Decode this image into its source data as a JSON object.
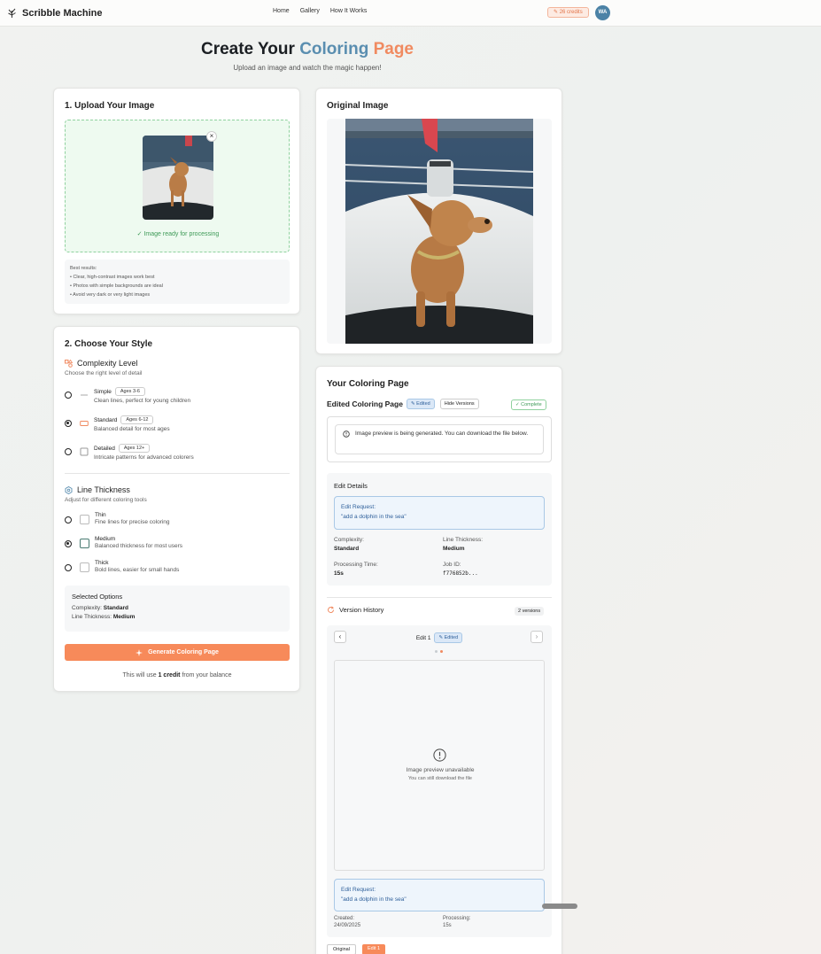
{
  "header": {
    "app_name": "Scribble Machine",
    "nav": [
      "Home",
      "Gallery",
      "How It Works"
    ],
    "credits": "✎ 26 credits",
    "avatar_initials": "WA"
  },
  "hero": {
    "title_part1": "Create Your ",
    "title_part2": "Coloring",
    "title_part3": " Page",
    "subtitle": "Upload an image and watch the magic happen!"
  },
  "upload": {
    "title": "1. Upload Your Image",
    "close": "×",
    "status": "✓ Image ready for processing",
    "tips_heading": "Best results:",
    "tips": [
      "• Clear, high-contrast images work best",
      "• Photos with simple backgrounds are ideal",
      "• Avoid very dark or very light images"
    ]
  },
  "style": {
    "title": "2. Choose Your Style",
    "complexity": {
      "heading": "Complexity Level",
      "sub": "Choose the right level of detail",
      "options": [
        {
          "label": "Simple",
          "age": "Ages 3-6",
          "desc": "Clean lines, perfect for young children",
          "selected": false
        },
        {
          "label": "Standard",
          "age": "Ages 6-12",
          "desc": "Balanced detail for most ages",
          "selected": true
        },
        {
          "label": "Detailed",
          "age": "Ages 12+",
          "desc": "Intricate patterns for advanced colorers",
          "selected": false
        }
      ]
    },
    "thickness": {
      "heading": "Line Thickness",
      "sub": "Adjust for different coloring tools",
      "options": [
        {
          "label": "Thin",
          "desc": "Fine lines for precise coloring",
          "selected": false
        },
        {
          "label": "Medium",
          "desc": "Balanced thickness for most users",
          "selected": true
        },
        {
          "label": "Thick",
          "desc": "Bold lines, easier for small hands",
          "selected": false
        }
      ]
    },
    "selected": {
      "heading": "Selected Options",
      "complexity_label": "Complexity:",
      "complexity_value": "Standard",
      "thickness_label": "Line Thickness:",
      "thickness_value": "Medium"
    },
    "generate_button": "Generate Coloring Page",
    "credit_note_pre": "This will use ",
    "credit_note_bold": "1 credit",
    "credit_note_post": " from your balance"
  },
  "original": {
    "title": "Original Image"
  },
  "result": {
    "title": "Your Coloring Page",
    "subtitle": "Edited Coloring Page",
    "edited_badge": "✎ Edited",
    "hide_versions": "Hide Versions",
    "complete_badge": "✓ Complete",
    "notice": "Image preview is being generated. You can download the file below.",
    "edit_details": {
      "heading": "Edit Details",
      "request_label": "Edit Request:",
      "request_text": "\"add a dolphin in the sea\"",
      "complexity_label": "Complexity:",
      "complexity_value": "Standard",
      "thickness_label": "Line Thickness:",
      "thickness_value": "Medium",
      "time_label": "Processing Time:",
      "time_value": "15s",
      "job_label": "Job ID:",
      "job_value": "f776852b..."
    },
    "history": {
      "heading": "Version History",
      "count": "2 versions",
      "current_label": "Edit 1",
      "current_badge": "✎ Edited",
      "prev": "‹",
      "next": "›",
      "unavailable": "Image preview unavailable",
      "unavailable_sub": "You can still download the file",
      "request_label": "Edit Request:",
      "request_text": "\"add a dolphin in the sea\"",
      "created_label": "Created:",
      "created_value": "24/09/2025",
      "processing_label": "Processing:",
      "processing_value": "15s",
      "tabs": [
        "Original",
        "Edit 1"
      ]
    }
  }
}
